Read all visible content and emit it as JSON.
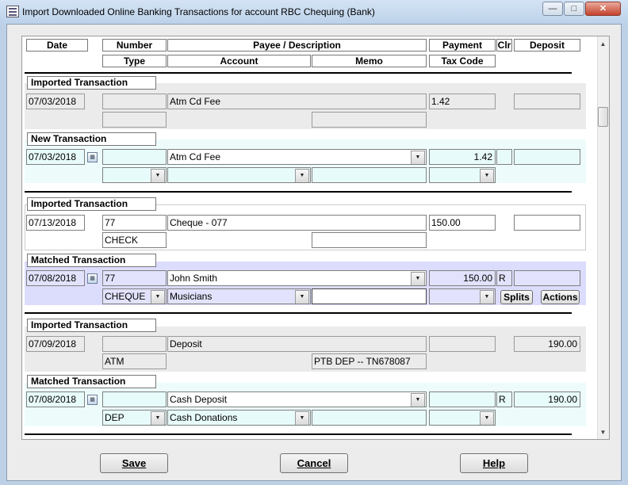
{
  "window": {
    "title": "Import Downloaded Online Banking Transactions for account RBC Chequing (Bank)",
    "minimize": "—",
    "maximize": "□",
    "close": "✕"
  },
  "headers": {
    "date": "Date",
    "number": "Number",
    "payee": "Payee / Description",
    "payment": "Payment",
    "clr": "Clr",
    "deposit": "Deposit",
    "type": "Type",
    "account": "Account",
    "memo": "Memo",
    "taxcode": "Tax Code"
  },
  "sections": {
    "imported_label": "Imported Transaction",
    "new_label": "New Transaction",
    "matched_label": "Matched Transaction"
  },
  "t1": {
    "imported": {
      "date": "07/03/2018",
      "number": "",
      "payee": "Atm Cd Fee",
      "payment": "1.42",
      "deposit": "",
      "type": "",
      "memo": ""
    },
    "new": {
      "date": "07/03/2018",
      "number": "",
      "payee": "Atm Cd Fee",
      "payment": "1.42",
      "clr": "",
      "deposit": "",
      "type": "",
      "account": "",
      "memo": "",
      "taxcode": ""
    }
  },
  "t2": {
    "imported": {
      "date": "07/13/2018",
      "number": "77",
      "payee": "Cheque - 077",
      "payment": "150.00",
      "deposit": "",
      "type": "CHECK",
      "memo": ""
    },
    "matched": {
      "date": "07/08/2018",
      "number": "77",
      "payee": "John Smith",
      "payment": "150.00",
      "clr": "R",
      "deposit": "",
      "type": "CHEQUE",
      "account": "Musicians",
      "memo": "",
      "taxcode": "",
      "splits": "Splits",
      "actions": "Actions"
    }
  },
  "t3": {
    "imported": {
      "date": "07/09/2018",
      "number": "",
      "payee": "Deposit",
      "payment": "",
      "deposit": "190.00",
      "type": "ATM",
      "memo": "PTB DEP -- TN678087"
    },
    "matched": {
      "date": "07/08/2018",
      "number": "",
      "payee": "Cash Deposit",
      "payment": "",
      "clr": "R",
      "deposit": "190.00",
      "type": "DEP",
      "account": "Cash Donations",
      "memo": "",
      "taxcode": ""
    }
  },
  "buttons": {
    "save": "Save",
    "cancel": "Cancel",
    "help": "Help"
  },
  "glyphs": {
    "dropdown": "▼",
    "calendar": "▦",
    "scroll_up": "▲",
    "scroll_down": "▼"
  }
}
